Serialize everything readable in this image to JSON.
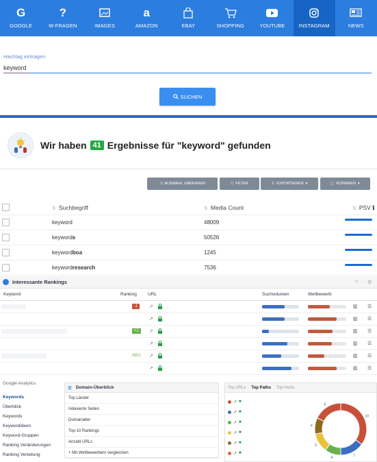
{
  "nav": [
    {
      "label": "GOOGLE",
      "icon": "google-icon"
    },
    {
      "label": "W-FRAGEN",
      "icon": "question-icon"
    },
    {
      "label": "IMAGES",
      "icon": "image-icon"
    },
    {
      "label": "AMAZON",
      "icon": "amazon-icon"
    },
    {
      "label": "EBAY",
      "icon": "bag-icon"
    },
    {
      "label": "SHOPPING",
      "icon": "cart-icon"
    },
    {
      "label": "YOUTUBE",
      "icon": "youtube-icon"
    },
    {
      "label": "INSTAGRAM",
      "icon": "instagram-icon"
    },
    {
      "label": "NEWS",
      "icon": "news-icon"
    }
  ],
  "active_nav": "INSTAGRAM",
  "search": {
    "placeholder": "Hashtag eintragen",
    "value": "keyword",
    "button": "SUCHEN"
  },
  "result": {
    "prefix": "Wir haben",
    "count": "41",
    "suffix": "Ergebnisse für \"keyword\" gefunden"
  },
  "toolbar": {
    "invert": "AUSWAHL UMKEHREN",
    "filter": "FILTER",
    "export": "EXPORTIEREN",
    "copy": "KOPIEREN"
  },
  "table": {
    "headers": {
      "keyword": "Suchbegriff",
      "count": "Media Count",
      "psv": "PSV"
    },
    "rows": [
      {
        "base": "keyword",
        "bold": "",
        "count": "48009"
      },
      {
        "base": "keyword",
        "bold": "s",
        "count": "50526"
      },
      {
        "base": "keyword",
        "bold": "boa",
        "count": "1245"
      },
      {
        "base": "keyword",
        "bold": "research",
        "count": "7536"
      }
    ]
  },
  "rankings": {
    "title": "Interessante Rankings",
    "cols": {
      "keyword": "Keyword",
      "ranking": "Ranking",
      "url": "URL",
      "vol": "Suchvolumen",
      "comp": "Wettbewerb"
    },
    "rows": [
      {
        "badge": "-1",
        "badge_color": "#c8503a",
        "vol": 0.62,
        "comp": 0.58
      },
      {
        "badge": "",
        "badge_color": "",
        "vol": 0.62,
        "comp": 0.75
      },
      {
        "badge": "+1",
        "badge_color": "#6ab04c",
        "vol": 0.18,
        "comp": 0.65
      },
      {
        "badge": "",
        "badge_color": "",
        "vol": 0.68,
        "comp": 0.62
      },
      {
        "badge": "NEU",
        "badge_color": "",
        "vol": 0.52,
        "comp": 0.42
      },
      {
        "badge": "",
        "badge_color": "",
        "vol": 0.8,
        "comp": 0.75
      }
    ]
  },
  "sidebar": {
    "title": "Google Analytics",
    "items": [
      "Keywords",
      "Überblick",
      "Keywords",
      "Keywordideen",
      "Keyword-Gruppen",
      "Ranking Veränderungen",
      "Ranking Verteilung"
    ]
  },
  "domain": {
    "title": "Domain-Überblick",
    "rows": [
      "Top Länder",
      "Indexierte Seiten",
      "Domainalter",
      "Top-10 Rankings",
      "Anzahl URLs",
      "Mit Wettbewerbern vergleichen"
    ]
  },
  "toppaths": {
    "tabs": [
      "Top URLs",
      "Top Paths",
      "Top Hosts"
    ],
    "dots": [
      "#c8503a",
      "#3c6fc2",
      "#6ab04c",
      "#e8c23c",
      "#8b6b1f",
      "#e06040"
    ],
    "donut_labels": [
      "10",
      "7",
      "4",
      "5",
      "4",
      "5"
    ]
  }
}
